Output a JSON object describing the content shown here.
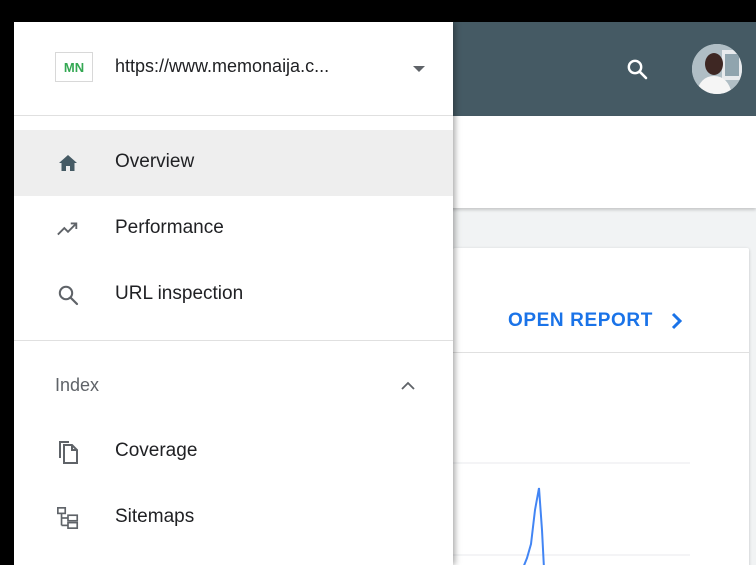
{
  "property": {
    "logo_text": "MN",
    "url": "https://www.memonaija.c..."
  },
  "nav": {
    "items": [
      {
        "label": "Overview",
        "icon": "home-icon"
      },
      {
        "label": "Performance",
        "icon": "trending-up-icon"
      },
      {
        "label": "URL inspection",
        "icon": "search-icon"
      }
    ]
  },
  "index_section": {
    "label": "Index",
    "items": [
      {
        "label": "Coverage",
        "icon": "coverage-icon"
      },
      {
        "label": "Sitemaps",
        "icon": "sitemap-icon"
      }
    ]
  },
  "card": {
    "open_report_label": "OPEN REPORT"
  },
  "colors": {
    "topbar": "#455a64",
    "accent": "#1a73e8",
    "logo_green": "#34a853"
  }
}
